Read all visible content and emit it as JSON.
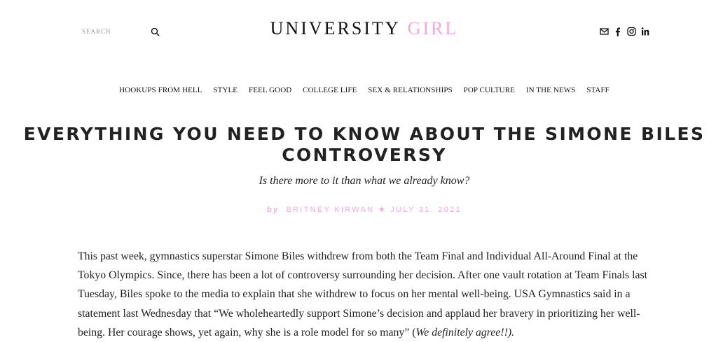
{
  "header": {
    "search": {
      "placeholder": "SEARCH"
    },
    "logo": {
      "word1": "UNIVERSITY",
      "word2": "GIRL",
      "accent_color": "#f4a9d8"
    },
    "social_icons": [
      "mail-icon",
      "facebook-icon",
      "instagram-icon",
      "linkedin-icon"
    ]
  },
  "nav": {
    "items": [
      "HOOKUPS FROM HELL",
      "STYLE",
      "FEEL GOOD",
      "COLLEGE LIFE",
      "SEX & RELATIONSHIPS",
      "POP CULTURE",
      "IN THE NEWS",
      "STAFF"
    ]
  },
  "article": {
    "title": "EVERYTHING YOU NEED TO KNOW ABOUT THE SIMONE BILES CONTROVERSY",
    "subtitle": "Is there more to it than what we already know?",
    "byline": {
      "by": "by",
      "author": "BRITNEY KIRWAN",
      "date": "JULY 31, 2021"
    },
    "body_text": "This past week, gymnastics superstar Simone Biles withdrew from both the Team Final and Individual All-Around Final at the Tokyo Olympics. Since, there has been a lot of controversy surrounding her decision. After one vault rotation at Team Finals last Tuesday, Biles spoke to the media to explain that she withdrew to focus on her mental well-being. USA Gymnastics said in a statement last Wednesday that “We wholeheartedly support Simone’s decision and applaud her bravery in prioritizing her well-being. Her courage shows, yet again, why she is a role model for so many” (",
    "body_emphasis": "We definitely agree!!).",
    "text_color": "#222222"
  }
}
